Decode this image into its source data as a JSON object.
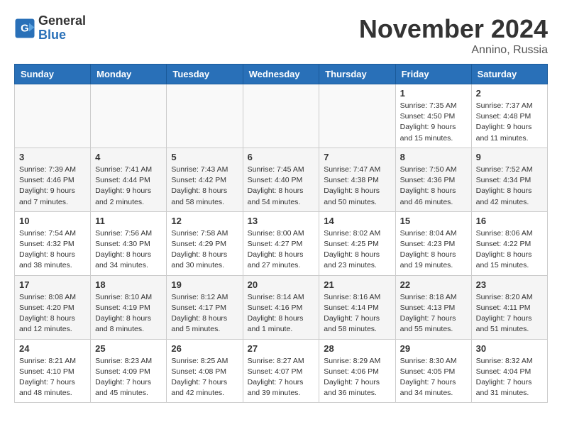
{
  "header": {
    "logo_general": "General",
    "logo_blue": "Blue",
    "month_title": "November 2024",
    "location": "Annino, Russia"
  },
  "weekdays": [
    "Sunday",
    "Monday",
    "Tuesday",
    "Wednesday",
    "Thursday",
    "Friday",
    "Saturday"
  ],
  "weeks": [
    [
      {
        "day": "",
        "info": ""
      },
      {
        "day": "",
        "info": ""
      },
      {
        "day": "",
        "info": ""
      },
      {
        "day": "",
        "info": ""
      },
      {
        "day": "",
        "info": ""
      },
      {
        "day": "1",
        "info": "Sunrise: 7:35 AM\nSunset: 4:50 PM\nDaylight: 9 hours and 15 minutes."
      },
      {
        "day": "2",
        "info": "Sunrise: 7:37 AM\nSunset: 4:48 PM\nDaylight: 9 hours and 11 minutes."
      }
    ],
    [
      {
        "day": "3",
        "info": "Sunrise: 7:39 AM\nSunset: 4:46 PM\nDaylight: 9 hours and 7 minutes."
      },
      {
        "day": "4",
        "info": "Sunrise: 7:41 AM\nSunset: 4:44 PM\nDaylight: 9 hours and 2 minutes."
      },
      {
        "day": "5",
        "info": "Sunrise: 7:43 AM\nSunset: 4:42 PM\nDaylight: 8 hours and 58 minutes."
      },
      {
        "day": "6",
        "info": "Sunrise: 7:45 AM\nSunset: 4:40 PM\nDaylight: 8 hours and 54 minutes."
      },
      {
        "day": "7",
        "info": "Sunrise: 7:47 AM\nSunset: 4:38 PM\nDaylight: 8 hours and 50 minutes."
      },
      {
        "day": "8",
        "info": "Sunrise: 7:50 AM\nSunset: 4:36 PM\nDaylight: 8 hours and 46 minutes."
      },
      {
        "day": "9",
        "info": "Sunrise: 7:52 AM\nSunset: 4:34 PM\nDaylight: 8 hours and 42 minutes."
      }
    ],
    [
      {
        "day": "10",
        "info": "Sunrise: 7:54 AM\nSunset: 4:32 PM\nDaylight: 8 hours and 38 minutes."
      },
      {
        "day": "11",
        "info": "Sunrise: 7:56 AM\nSunset: 4:30 PM\nDaylight: 8 hours and 34 minutes."
      },
      {
        "day": "12",
        "info": "Sunrise: 7:58 AM\nSunset: 4:29 PM\nDaylight: 8 hours and 30 minutes."
      },
      {
        "day": "13",
        "info": "Sunrise: 8:00 AM\nSunset: 4:27 PM\nDaylight: 8 hours and 27 minutes."
      },
      {
        "day": "14",
        "info": "Sunrise: 8:02 AM\nSunset: 4:25 PM\nDaylight: 8 hours and 23 minutes."
      },
      {
        "day": "15",
        "info": "Sunrise: 8:04 AM\nSunset: 4:23 PM\nDaylight: 8 hours and 19 minutes."
      },
      {
        "day": "16",
        "info": "Sunrise: 8:06 AM\nSunset: 4:22 PM\nDaylight: 8 hours and 15 minutes."
      }
    ],
    [
      {
        "day": "17",
        "info": "Sunrise: 8:08 AM\nSunset: 4:20 PM\nDaylight: 8 hours and 12 minutes."
      },
      {
        "day": "18",
        "info": "Sunrise: 8:10 AM\nSunset: 4:19 PM\nDaylight: 8 hours and 8 minutes."
      },
      {
        "day": "19",
        "info": "Sunrise: 8:12 AM\nSunset: 4:17 PM\nDaylight: 8 hours and 5 minutes."
      },
      {
        "day": "20",
        "info": "Sunrise: 8:14 AM\nSunset: 4:16 PM\nDaylight: 8 hours and 1 minute."
      },
      {
        "day": "21",
        "info": "Sunrise: 8:16 AM\nSunset: 4:14 PM\nDaylight: 7 hours and 58 minutes."
      },
      {
        "day": "22",
        "info": "Sunrise: 8:18 AM\nSunset: 4:13 PM\nDaylight: 7 hours and 55 minutes."
      },
      {
        "day": "23",
        "info": "Sunrise: 8:20 AM\nSunset: 4:11 PM\nDaylight: 7 hours and 51 minutes."
      }
    ],
    [
      {
        "day": "24",
        "info": "Sunrise: 8:21 AM\nSunset: 4:10 PM\nDaylight: 7 hours and 48 minutes."
      },
      {
        "day": "25",
        "info": "Sunrise: 8:23 AM\nSunset: 4:09 PM\nDaylight: 7 hours and 45 minutes."
      },
      {
        "day": "26",
        "info": "Sunrise: 8:25 AM\nSunset: 4:08 PM\nDaylight: 7 hours and 42 minutes."
      },
      {
        "day": "27",
        "info": "Sunrise: 8:27 AM\nSunset: 4:07 PM\nDaylight: 7 hours and 39 minutes."
      },
      {
        "day": "28",
        "info": "Sunrise: 8:29 AM\nSunset: 4:06 PM\nDaylight: 7 hours and 36 minutes."
      },
      {
        "day": "29",
        "info": "Sunrise: 8:30 AM\nSunset: 4:05 PM\nDaylight: 7 hours and 34 minutes."
      },
      {
        "day": "30",
        "info": "Sunrise: 8:32 AM\nSunset: 4:04 PM\nDaylight: 7 hours and 31 minutes."
      }
    ]
  ]
}
